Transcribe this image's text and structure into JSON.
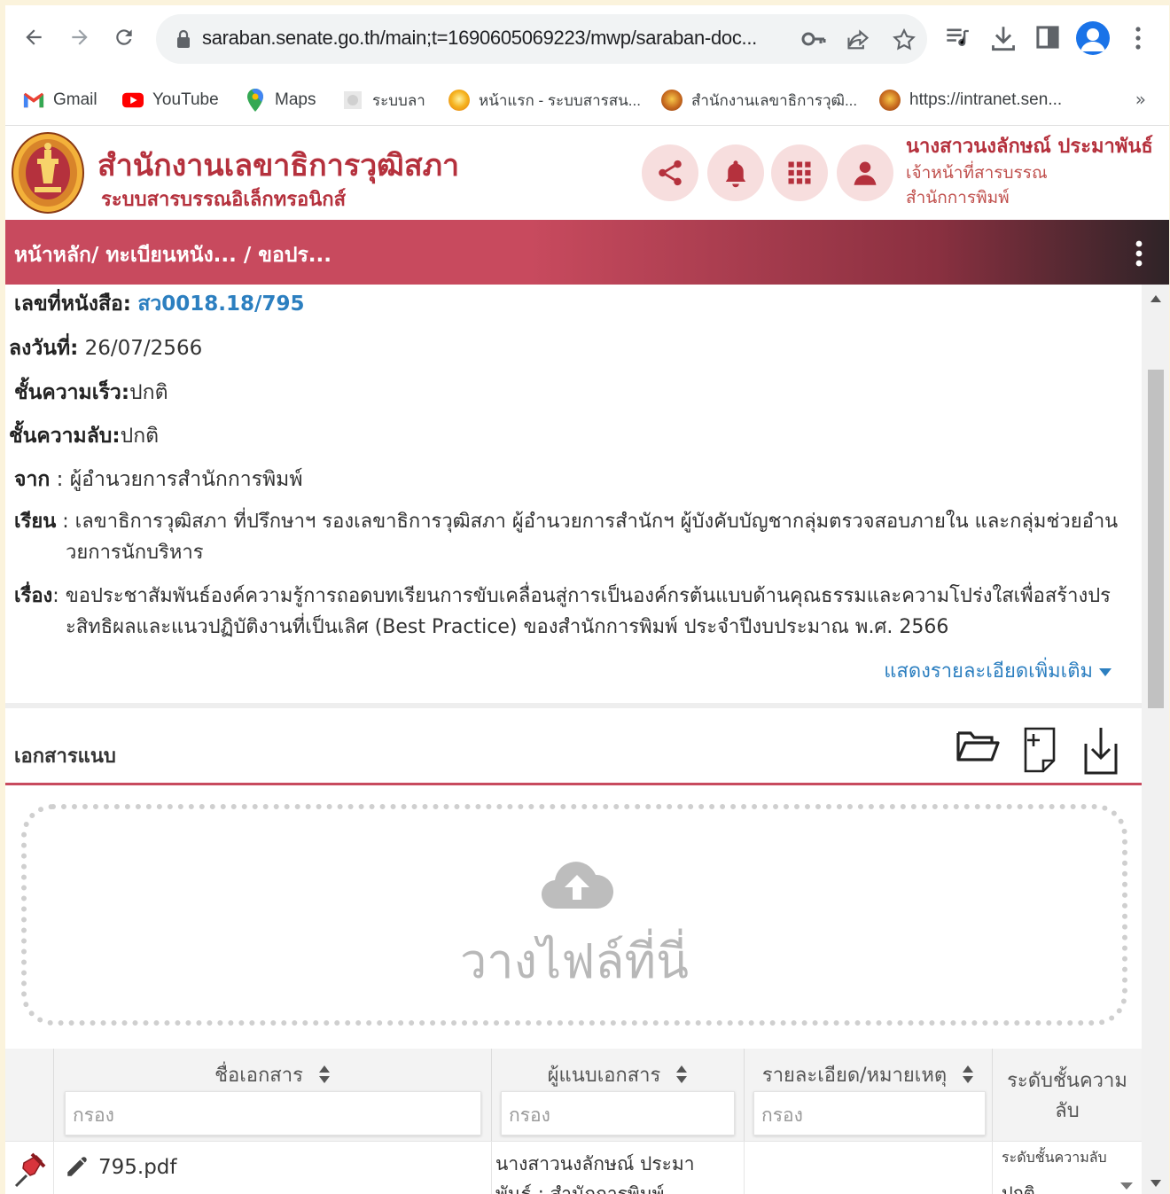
{
  "browser": {
    "url": "saraban.senate.go.th/main;t=1690605069223/mwp/saraban-doc...",
    "bookmarks": [
      {
        "label": "Gmail"
      },
      {
        "label": "YouTube"
      },
      {
        "label": "Maps"
      },
      {
        "label": "ระบบลา"
      },
      {
        "label": "หน้าแรก - ระบบสารสน..."
      },
      {
        "label": "สำนักงานเลขาธิการวุฒิ..."
      },
      {
        "label": "https://intranet.sen..."
      }
    ],
    "more_bookmarks": "»"
  },
  "header": {
    "org_title": "สำนักงานเลขาธิการวุฒิสภา",
    "org_subtitle": "ระบบสารบรรณอิเล็กทรอนิกส์",
    "user_name": "นางสาวนงลักษณ์ ประมาพันธ์",
    "user_role": "เจ้าหน้าที่สารบรรณ",
    "user_dept": "สำนักการพิมพ์",
    "accent_color": "#b5313d"
  },
  "breadcrumb": "หน้าหลัก/ ทะเบียนหนัง... / ขอปร...",
  "document": {
    "doc_no_label": "เลขที่หนังสือ:",
    "doc_no_value": "สว0018.18/795",
    "date_label": "ลงวันที่:",
    "date_value": "26/07/2566",
    "urgency_label": "ชั้นความเร็ว:",
    "urgency_value": "ปกติ",
    "secrecy_label": "ชั้นความลับ:",
    "secrecy_value": "ปกติ",
    "from_label": "จาก",
    "from_value": "ผู้อำนวยการสำนักการพิมพ์",
    "to_label": "เรียน",
    "to_value_1": "เลขาธิการวุฒิสภา ที่ปรึกษาฯ รองเลขาธิการวุฒิสภา ผู้อำนวยการสำนักฯ ผู้บังคับบัญชากลุ่มตรวจสอบภายใน และกลุ่มช่วยอำน",
    "to_value_2": "วยการนักบริหาร",
    "subject_label": "เรื่อง",
    "subject_value_1": "ขอประชาสัมพันธ์องค์ความรู้การถอดบทเรียนการขับเคลื่อนสู่การเป็นองค์กรต้นแบบด้านคุณธรรมและความโปร่งใสเพื่อสร้างปร",
    "subject_value_2": "ะสิทธิผลและแนวปฏิบัติงานที่เป็นเลิศ (Best Practice) ของสำนักการพิมพ์ ประจำปีงบประมาณ พ.ศ. 2566",
    "more_link": "แสดงรายละเอียดเพิ่มเติม"
  },
  "attachments": {
    "title": "เอกสารแนบ",
    "dropzone_text": "วางไฟล์ที่นี่",
    "columns": [
      {
        "label": "ชื่อเอกสาร",
        "filter_placeholder": "กรอง"
      },
      {
        "label": "ผู้แนบเอกสาร",
        "filter_placeholder": "กรอง"
      },
      {
        "label": "รายละเอียด/หมายเหตุ",
        "filter_placeholder": "กรอง"
      },
      {
        "label_1": "ระดับชั้นความ",
        "label_2": "ลับ"
      }
    ],
    "rows": [
      {
        "file_name": "795.pdf",
        "attached_by_1": "นางสาวนงลักษณ์ ประมา",
        "attached_by_2": "พันธ์ : สำนักการพิมพ์",
        "detail": "",
        "secrecy_label": "ระดับชั้นความลับ",
        "secrecy_value": "ปกติ"
      }
    ]
  }
}
